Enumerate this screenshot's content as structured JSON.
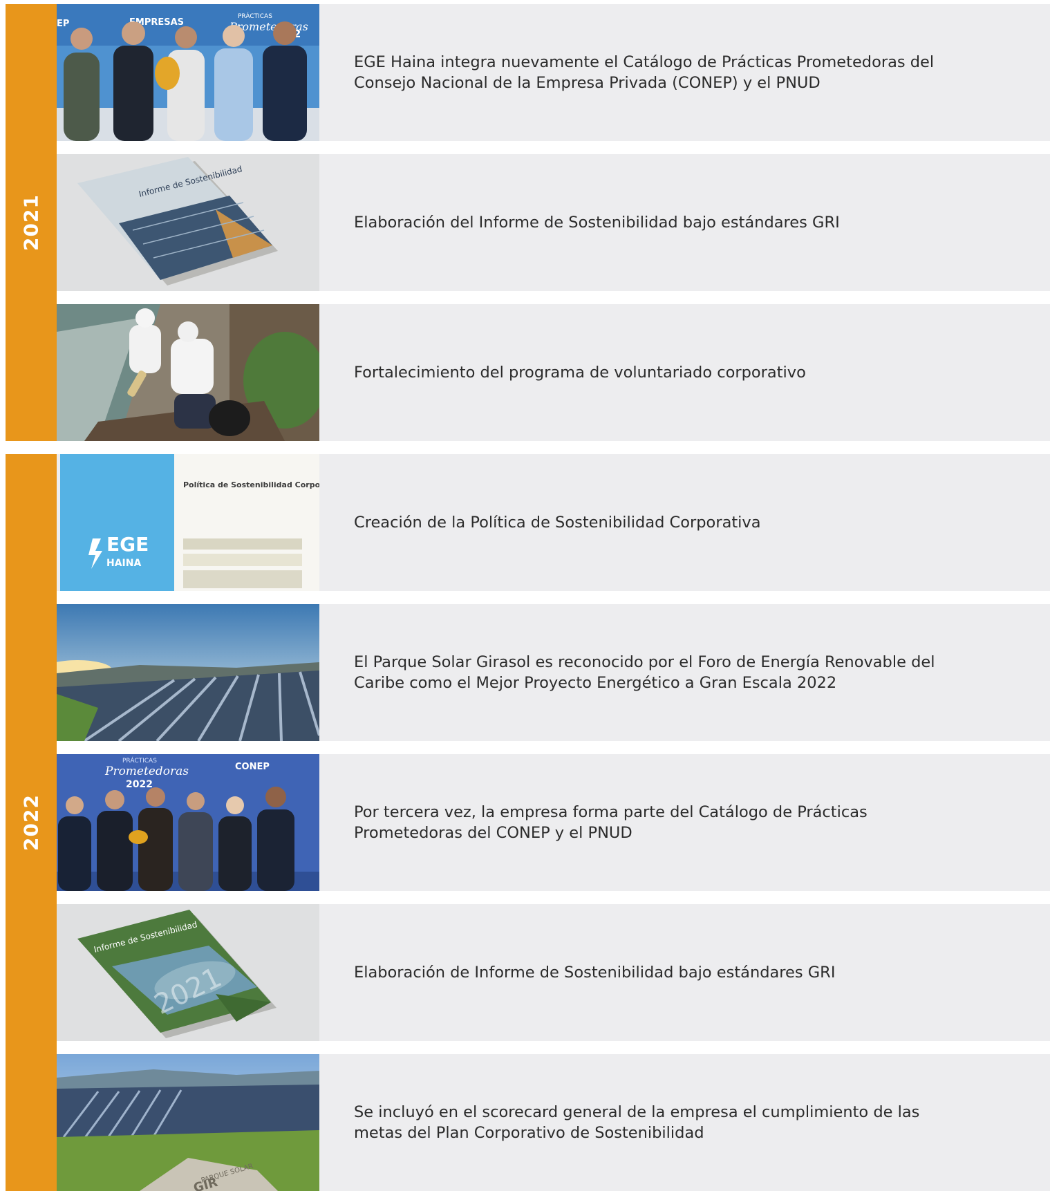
{
  "colors": {
    "accent": "#e8961b",
    "row_background": "#ededef",
    "text": "#2b2b2b"
  },
  "groups": [
    {
      "year": "2021",
      "items": [
        {
          "text": "EGE Haina integra nuevamente el Catálogo de Prácticas Prometedoras del Consejo Nacional de la Empresa Privada (CONEP) y el PNUD",
          "image": "award-ceremony-photo",
          "image_texts": [
            "EMPRESAS",
            "PRÁCTICAS",
            "Prometedoras",
            "202",
            "EP"
          ]
        },
        {
          "text": "Elaboración del Informe de Sostenibilidad bajo estándares GRI",
          "image": "sustainability-report-cover",
          "image_texts": [
            "Informe de Sostenibilidad"
          ]
        },
        {
          "text": "Fortalecimiento del programa de voluntariado corporativo",
          "image": "volunteer-beach-cleanup-photo",
          "image_texts": []
        }
      ]
    },
    {
      "year": "2022",
      "items": [
        {
          "text": "Creación de la Política de Sostenibilidad Corporativa",
          "image": "policy-document-cover",
          "image_texts": [
            "Política de Sostenibilidad Corporativa",
            "EGE",
            "HAINA"
          ]
        },
        {
          "text": "El Parque Solar Girasol es reconocido por el Foro de Energía Renovable del Caribe como el Mejor Proyecto Energético a Gran Escala 2022",
          "image": "solar-park-landscape-photo",
          "image_texts": []
        },
        {
          "text": "Por tercera vez, la empresa forma parte del Catálogo de Prácticas Prometedoras del CONEP y el PNUD",
          "image": "award-ceremony-photo",
          "image_texts": [
            "PRÁCTICAS",
            "Prometedoras",
            "2022",
            "CONEP"
          ]
        },
        {
          "text": "Elaboración de Informe de Sostenibilidad bajo estándares GRI",
          "image": "sustainability-report-cover",
          "image_texts": [
            "Informe de Sostenibilidad",
            "2021"
          ]
        },
        {
          "text": "Se incluyó en el scorecard general de la empresa el cumplimiento de las metas del Plan Corporativo de Sostenibilidad",
          "image": "solar-park-sign-photo",
          "image_texts": [
            "PARQUE SOLAR",
            "GIR"
          ]
        }
      ]
    }
  ]
}
